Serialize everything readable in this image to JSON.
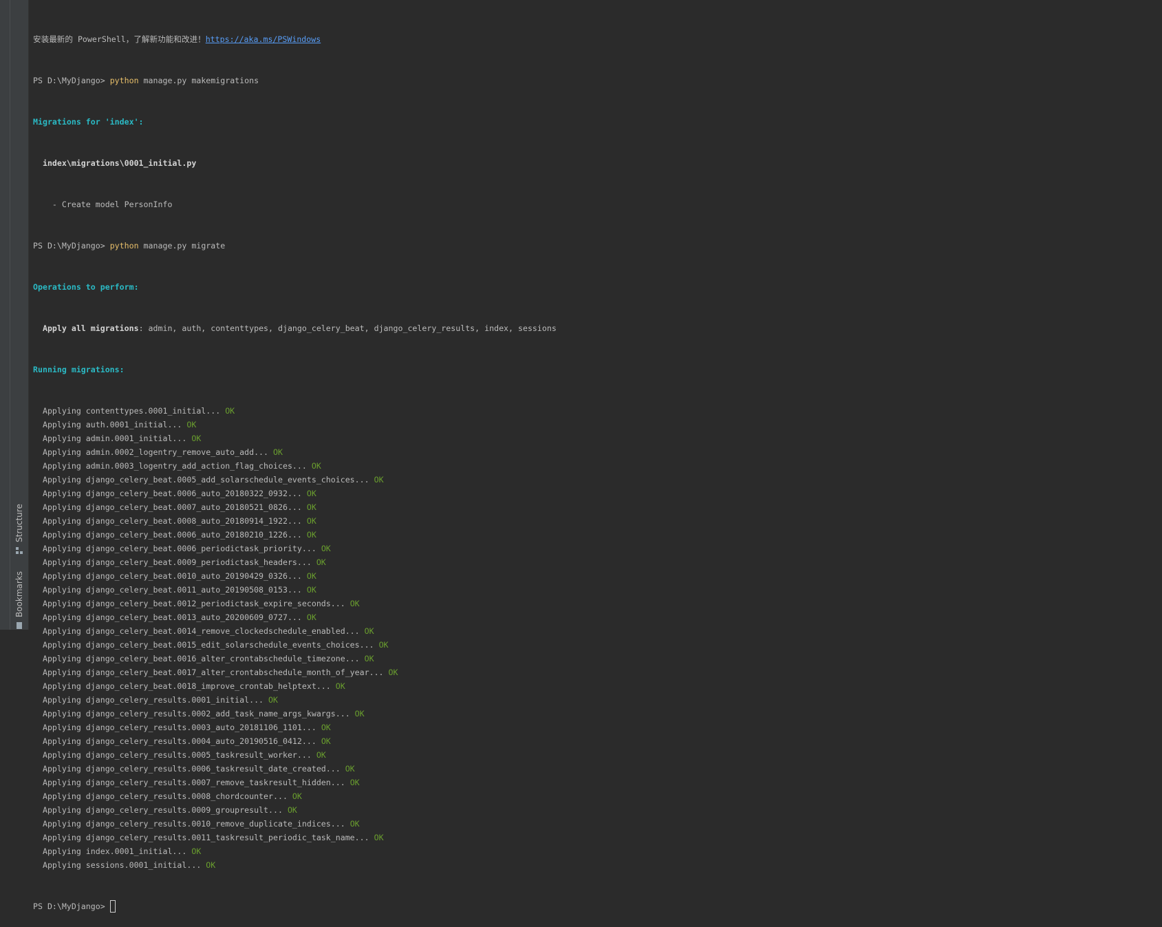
{
  "banner": {
    "text": "安装最新的 PowerShell，了解新功能和改进！",
    "link": "https://aka.ms/PSWindows"
  },
  "prompt": "PS D:\\MyDjango> ",
  "commands": {
    "makemigrations": {
      "program": "python",
      "args": " manage.py makemigrations"
    },
    "migrate": {
      "program": "python",
      "args": " manage.py migrate"
    }
  },
  "makemigrations_output": {
    "header": "Migrations for 'index':",
    "file": "  index\\migrations\\0001_initial.py",
    "action": "    - Create model PersonInfo"
  },
  "migrate_output": {
    "ops_header": "Operations to perform:",
    "apply_label": "  Apply all migrations",
    "apply_list": ": admin, auth, contenttypes, django_celery_beat, django_celery_results, index, sessions",
    "running_header": "Running migrations:",
    "ok": "OK",
    "migrations": [
      "  Applying contenttypes.0001_initial... ",
      "  Applying auth.0001_initial... ",
      "  Applying admin.0001_initial... ",
      "  Applying admin.0002_logentry_remove_auto_add... ",
      "  Applying admin.0003_logentry_add_action_flag_choices... ",
      "  Applying django_celery_beat.0005_add_solarschedule_events_choices... ",
      "  Applying django_celery_beat.0006_auto_20180322_0932... ",
      "  Applying django_celery_beat.0007_auto_20180521_0826... ",
      "  Applying django_celery_beat.0008_auto_20180914_1922... ",
      "  Applying django_celery_beat.0006_auto_20180210_1226... ",
      "  Applying django_celery_beat.0006_periodictask_priority... ",
      "  Applying django_celery_beat.0009_periodictask_headers... ",
      "  Applying django_celery_beat.0010_auto_20190429_0326... ",
      "  Applying django_celery_beat.0011_auto_20190508_0153... ",
      "  Applying django_celery_beat.0012_periodictask_expire_seconds... ",
      "  Applying django_celery_beat.0013_auto_20200609_0727... ",
      "  Applying django_celery_beat.0014_remove_clockedschedule_enabled... ",
      "  Applying django_celery_beat.0015_edit_solarschedule_events_choices... ",
      "  Applying django_celery_beat.0016_alter_crontabschedule_timezone... ",
      "  Applying django_celery_beat.0017_alter_crontabschedule_month_of_year... ",
      "  Applying django_celery_beat.0018_improve_crontab_helptext... ",
      "  Applying django_celery_results.0001_initial... ",
      "  Applying django_celery_results.0002_add_task_name_args_kwargs... ",
      "  Applying django_celery_results.0003_auto_20181106_1101... ",
      "  Applying django_celery_results.0004_auto_20190516_0412... ",
      "  Applying django_celery_results.0005_taskresult_worker... ",
      "  Applying django_celery_results.0006_taskresult_date_created... ",
      "  Applying django_celery_results.0007_remove_taskresult_hidden... ",
      "  Applying django_celery_results.0008_chordcounter... ",
      "  Applying django_celery_results.0009_groupresult... ",
      "  Applying django_celery_results.0010_remove_duplicate_indices... ",
      "  Applying django_celery_results.0011_taskresult_periodic_task_name... ",
      "  Applying index.0001_initial... ",
      "  Applying sessions.0001_initial... "
    ]
  },
  "side_tools": {
    "structure": {
      "label": "Structure",
      "icon": "structure-icon"
    },
    "bookmarks": {
      "label": "Bookmarks",
      "icon": "bookmark-icon"
    }
  },
  "colors": {
    "background": "#2b2b2b",
    "text": "#bbbbbb",
    "command": "#e8bf6a",
    "header": "#2bbac5",
    "ok": "#6a9f2e",
    "link": "#589df6"
  }
}
